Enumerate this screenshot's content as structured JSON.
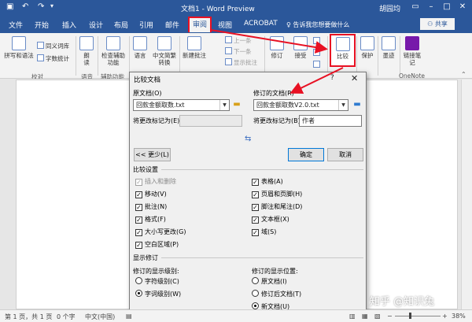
{
  "window": {
    "title": "文档1 - Word Preview",
    "user": "胡园均",
    "share_label": "共享",
    "tellme": "告诉我您想要做什么"
  },
  "tabs": [
    "文件",
    "开始",
    "插入",
    "设计",
    "布局",
    "引用",
    "邮件",
    "审阅",
    "视图",
    "ACROBAT"
  ],
  "ribbon": {
    "proofing": {
      "spell": "拼写和语法",
      "thesaurus": "同义词库",
      "wordcount": "字数统计",
      "group": "校对"
    },
    "speech": {
      "read": "朗读",
      "group": "语音"
    },
    "accessibility": {
      "check": "检查辅助功能",
      "group": "辅助功能"
    },
    "language": {
      "lang": "语言",
      "convert": "中文简繁转换"
    },
    "comments": {
      "new": "新建批注",
      "prev": "上一条",
      "next": "下一条",
      "show": "显示批注"
    },
    "tracking": {
      "track": "修订"
    },
    "changes": {
      "accept": "接受"
    },
    "compare": {
      "label": "比较"
    },
    "protect": {
      "label": "保护"
    },
    "ink": {
      "label": "墨迹"
    },
    "onenote": {
      "label": "链接笔记",
      "group": "OneNote"
    }
  },
  "dialog": {
    "title": "比较文档",
    "help": "?",
    "original_label": "原文档(O)",
    "original_value": "回款金额取数.txt",
    "original_mark_label": "将更改标记为(E)",
    "original_mark_value": "",
    "revised_label": "修订的文档(R)",
    "revised_value": "回款金额取数V2.0.txt",
    "revised_mark_label": "将更改标记为(B)",
    "revised_mark_value": "作者",
    "swap_icon": "⇆",
    "less_button": "<< 更少(L)",
    "ok_button": "确定",
    "cancel_button": "取消",
    "settings_title": "比较设置",
    "settings_left": [
      {
        "label": "插入和删除",
        "checked": true,
        "disabled": true
      },
      {
        "label": "移动(V)",
        "checked": true,
        "disabled": false
      },
      {
        "label": "批注(N)",
        "checked": true,
        "disabled": false
      },
      {
        "label": "格式(F)",
        "checked": true,
        "disabled": false
      },
      {
        "label": "大小写更改(G)",
        "checked": true,
        "disabled": false
      },
      {
        "label": "空白区域(P)",
        "checked": true,
        "disabled": false
      }
    ],
    "settings_right": [
      {
        "label": "表格(A)",
        "checked": true
      },
      {
        "label": "页眉和页脚(H)",
        "checked": true
      },
      {
        "label": "脚注和尾注(D)",
        "checked": true
      },
      {
        "label": "文本框(X)",
        "checked": true
      },
      {
        "label": "域(S)",
        "checked": true
      }
    ],
    "display_title": "显示修订",
    "level_title": "修订的显示级别:",
    "levels": [
      {
        "label": "字符级别(C)",
        "selected": false
      },
      {
        "label": "字词级别(W)",
        "selected": true
      }
    ],
    "location_title": "修订的显示位置:",
    "locations": [
      {
        "label": "原文档(I)",
        "selected": false
      },
      {
        "label": "修订后文档(T)",
        "selected": false
      },
      {
        "label": "新文档(U)",
        "selected": true
      }
    ]
  },
  "status": {
    "page": "第 1 页，共 1 页",
    "words": "0 个字",
    "lang": "中文(中国)",
    "zoom": "38%"
  },
  "watermark": "知乎 @知识兔",
  "colors": {
    "accent": "#2b579a",
    "highlight": "#e81123"
  }
}
